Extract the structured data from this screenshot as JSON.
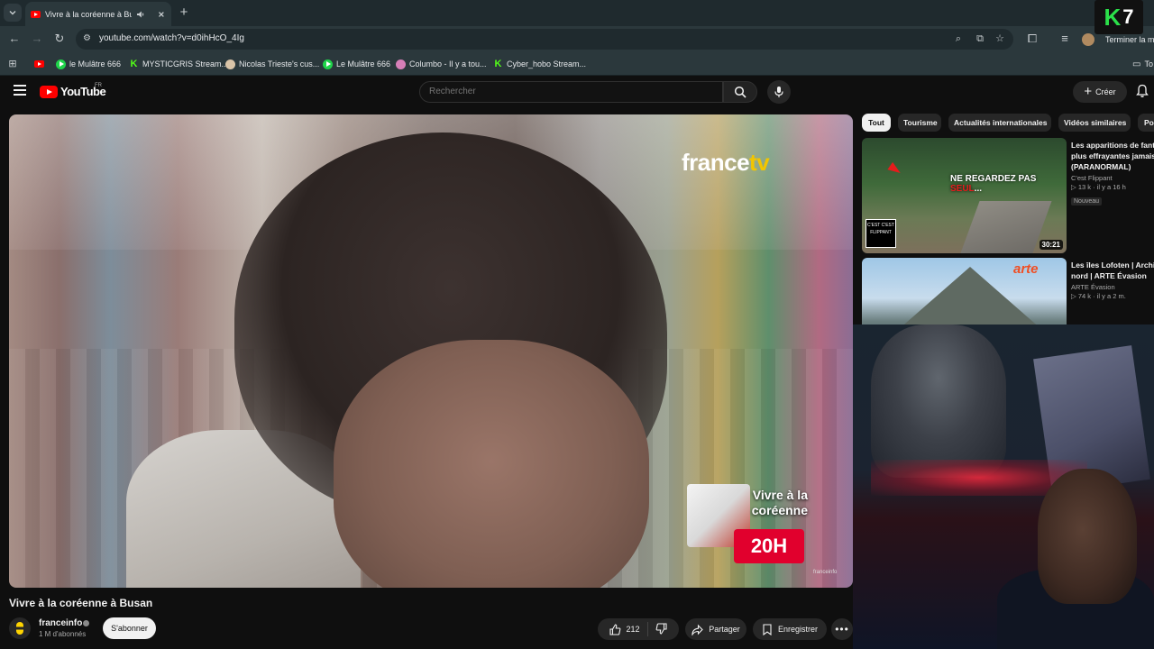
{
  "browser": {
    "tab_title": "Vivre à la coréenne à Busan",
    "url": "youtube.com/watch?v=d0ihHcO_4Ig",
    "finish_update_label": "Terminer la m",
    "bookmarks": [
      {
        "label": "",
        "icon": "youtube-icon"
      },
      {
        "label": "le Mulâtre 666",
        "icon": "play-icon"
      },
      {
        "label": "MYSTICGRIS Stream...",
        "icon": "kick-icon"
      },
      {
        "label": "Nicolas Trieste's cus...",
        "icon": "rabbit-icon"
      },
      {
        "label": "Le Mulâtre 666",
        "icon": "play-icon"
      },
      {
        "label": "Columbo - Il y a tou...",
        "icon": "columbo-icon"
      },
      {
        "label": "Cyber_hobo Stream...",
        "icon": "kick-icon"
      },
      {
        "label": "To",
        "icon": "folder-icon"
      }
    ]
  },
  "overlay": {
    "k7_logo_k": "K",
    "k7_logo_7": "7"
  },
  "youtube": {
    "logo_text": "YouTube",
    "country_code": "FR",
    "search_placeholder": "Rechercher",
    "create_label": "Créer"
  },
  "video": {
    "title": "Vivre à la coréenne à Busan",
    "broadcaster_logo": "france",
    "broadcaster_logo_suffix": "tv",
    "promo_title": "Vivre à la coréenne",
    "promo_time": "20H",
    "watermark": "franceinfo",
    "channel_name": "franceinfo",
    "channel_subscribers": "1 M d'abonnés",
    "subscribe_label": "S'abonner",
    "likes": "212",
    "share_label": "Partager",
    "save_label": "Enregistrer"
  },
  "sidebar": {
    "chips": [
      "Tout",
      "Tourisme",
      "Actualités internationales",
      "Vidéos similaires",
      "Pou"
    ],
    "active_chip": "Tout",
    "recommendations": [
      {
        "title_lines": [
          "Les apparitions de fant",
          "plus effrayantes jamais",
          "(PARANORMAL)"
        ],
        "channel": "C'est Flippant",
        "meta": "▷ 13 k · il y a 16 h",
        "badge": "Nouveau",
        "duration": "30:21",
        "thumb_text": "NE REGARDEZ PAS ",
        "thumb_text_red": "SEUL",
        "thumb_text_end": "...",
        "thumb_logo": "C'EST C'EST FLIPPANT"
      },
      {
        "title_lines": [
          "Les îles Lofoten | Archip",
          "nord | ARTE Évasion"
        ],
        "channel": "ARTE Évasion",
        "meta": "▷ 74 k · il y a 2 m.",
        "thumb_brand": "arte"
      }
    ]
  }
}
